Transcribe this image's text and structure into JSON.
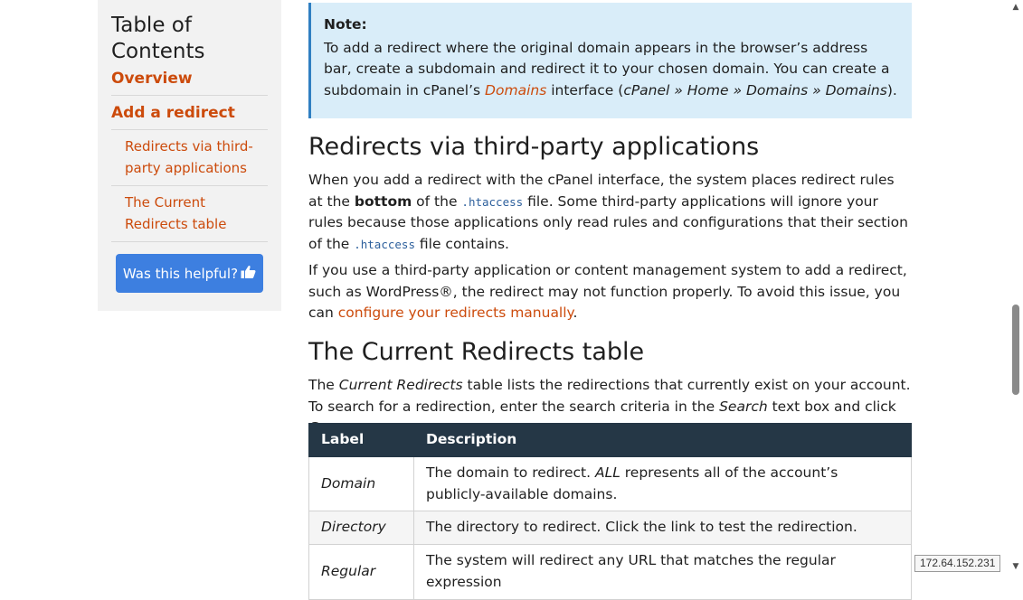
{
  "toc": {
    "title_line1": "Table of",
    "title_line2": "Contents",
    "items": [
      {
        "label": "Overview"
      },
      {
        "label": "Add a redirect"
      }
    ],
    "subitems": [
      {
        "line1": "Redirects via third-",
        "line2": "party applications"
      },
      {
        "line1": "The Current",
        "line2": "Redirects table"
      }
    ],
    "helpful_label": "Was this helpful?",
    "helpful_icon": "thumbs-up-icon"
  },
  "note": {
    "title": "Note:",
    "text_before": "To add a redirect where the original domain appears in the browser’s address bar, create a subdomain and redirect it to your chosen domain. You can create a subdomain in cPanel’s ",
    "link": "Domains",
    "text_mid": " interface (",
    "path": "cPanel » Home » Domains » Domains",
    "text_end": ")."
  },
  "section1": {
    "heading": "Redirects via third-party applications",
    "p1_a": "When you add a redirect with the cPanel interface, the system places redirect rules at the ",
    "p1_bold": "bottom",
    "p1_b": " of the ",
    "p1_code1": ".htaccess",
    "p1_c": " file. Some third-party applications will ignore your rules because those applications only read rules and configurations that their section of the ",
    "p1_code2": ".htaccess",
    "p1_d": " file contains.",
    "p2_a": "If you use a third-party application or content management system to add a redirect, such as WordPress®, the redirect may not function properly. To avoid this issue, you can ",
    "p2_link": "configure your redirects manually",
    "p2_b": "."
  },
  "section2": {
    "heading": "The Current Redirects table",
    "p_a": "The ",
    "p_em1": "Current Redirects",
    "p_b": " table lists the redirections that currently exist on your account. To search for a redirection, enter the search criteria in the ",
    "p_em2": "Search",
    "p_c": " text box and click ",
    "p_em3": "Go",
    "p_d": "."
  },
  "table": {
    "headers": [
      "Label",
      "Description"
    ],
    "rows": [
      {
        "label": "Domain",
        "desc_a": "The domain to redirect. ",
        "desc_em": "ALL",
        "desc_b": " represents all of the account’s publicly-available domains."
      },
      {
        "label": "Directory",
        "desc_a": "The directory to redirect. Click the link to test the redirection.",
        "desc_em": "",
        "desc_b": ""
      },
      {
        "label": "Regular",
        "desc_a": "The system will redirect any URL that matches the regular expression",
        "desc_em": "",
        "desc_b": ""
      }
    ]
  },
  "status": {
    "ip": "172.64.152.231"
  },
  "colors": {
    "link": "#cc4b0c",
    "note_bg": "#d9edf9",
    "table_header": "#253746",
    "button": "#3d7fe0"
  }
}
